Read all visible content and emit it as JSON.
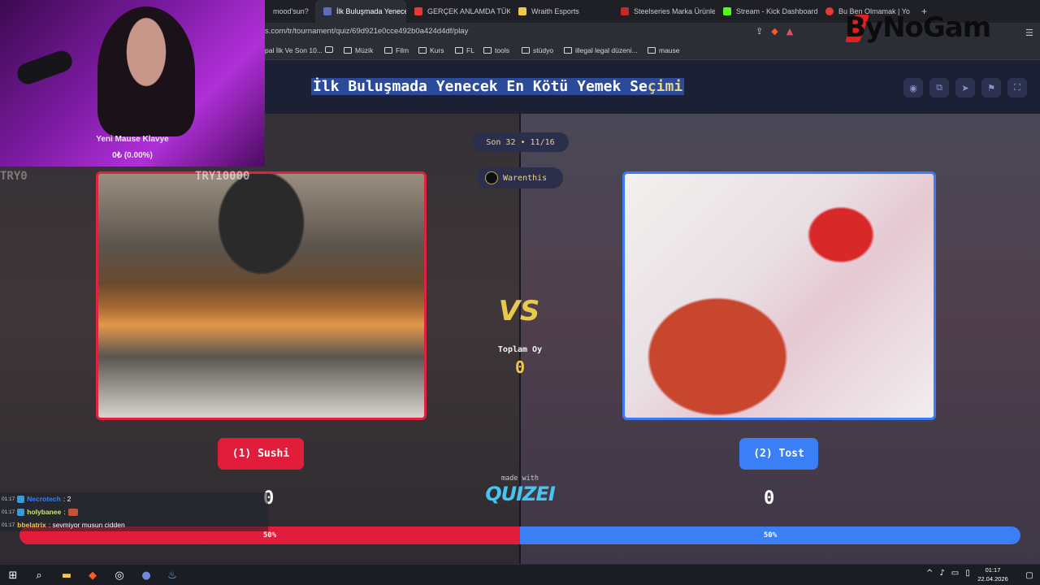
{
  "browser": {
    "tabs": [
      {
        "title": "mood'sun?",
        "color": "#2c2e36",
        "active": false
      },
      {
        "title": "İlk Buluşmada Yenece",
        "color": "#5c6bc0",
        "active": true
      },
      {
        "title": "GERÇEK ANLAMDA TÜKEN",
        "color": "#e53935",
        "active": false
      },
      {
        "title": "Wraith Esports",
        "color": "#f1c84a",
        "active": false
      },
      {
        "title": "Steelseries Marka Ürünler",
        "color": "#c62828",
        "active": false
      },
      {
        "title": "Stream - Kick Dashboard",
        "color": "#53fc18",
        "active": false
      },
      {
        "title": "Bu Ben Olmamak | Yo",
        "color": "#e53935",
        "active": false
      }
    ],
    "new_tab": "+",
    "url": "s.com/tr/tournament/quiz/69d921e0cce492b0a424d4df/play",
    "bookmarks": [
      "pal İlk Ve Son 10...",
      "Müzik",
      "Film",
      "Kurs",
      "FL",
      "tools",
      "stüdyo",
      "illegal legal düzeni...",
      "mause"
    ]
  },
  "quiz": {
    "title_main": "İlk Buluşmada Yenecek En Kötü Yemek Se",
    "title_end": "çimi",
    "round": "Son 32 • 11/16",
    "player": "Warenthis",
    "vs": "VS",
    "total_label": "Toplam Oy",
    "total_votes": "0",
    "options": [
      {
        "label": "(1) Sushi",
        "votes": "0",
        "percent": "50%",
        "color": "#e11d3b"
      },
      {
        "label": "(2) Tost",
        "votes": "0",
        "percent": "50%",
        "color": "#3a7ff6"
      }
    ],
    "made_with": "made with",
    "brand": "QUIZEI"
  },
  "overlay": {
    "cam_line1": "Yeni Mause Klavye",
    "cam_line2": "0₺ (0.00%)",
    "try_left": "TRY0",
    "try_mid": "TRY10000",
    "logo": "ByNoGam",
    "chat": [
      {
        "time": "01:17",
        "user": "Necrotech",
        "msg": ": 2",
        "color": "#3a7ff6"
      },
      {
        "time": "01:17",
        "user": "holybanee",
        "msg": ":",
        "color": "#c9e86a"
      },
      {
        "time": "01:17",
        "user": "bbelatrix",
        "msg": ": sevmiyor musun cidden",
        "color": "#f1c84a"
      }
    ]
  },
  "taskbar": {
    "time": "01:17",
    "date": "22.04.2026"
  }
}
